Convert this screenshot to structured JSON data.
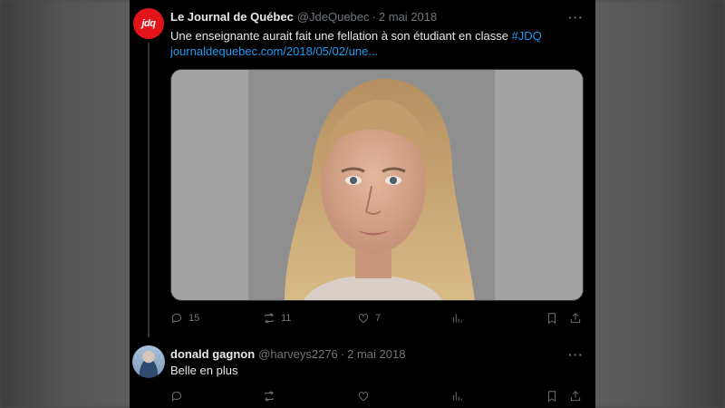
{
  "tweet": {
    "avatar_text": "jdq",
    "author": "Le Journal de Québec",
    "handle": "@JdeQuebec",
    "separator": "·",
    "date": "2 mai 2018",
    "text": "Une enseignante aurait fait une fellation à son étudiant en classe ",
    "hashtag": "#JDQ",
    "link": "journaldequebec.com/2018/05/02/une...",
    "more_icon": "more-horizontal-icon",
    "stats": {
      "replies": "15",
      "retweets": "11",
      "likes": "7"
    }
  },
  "reply": {
    "author": "donald gagnon",
    "handle": "@harveys2276",
    "separator": "·",
    "date": "2 mai 2018",
    "text": "Belle en plus",
    "more_icon": "more-horizontal-icon"
  },
  "icons": [
    "reply-icon",
    "retweet-icon",
    "like-icon",
    "views-icon",
    "bookmark-icon",
    "share-icon"
  ],
  "colors": {
    "background": "#000000",
    "brand": "#e3151b",
    "link": "#1d9bf0",
    "muted": "#71767b",
    "text": "#e7e9ea"
  }
}
